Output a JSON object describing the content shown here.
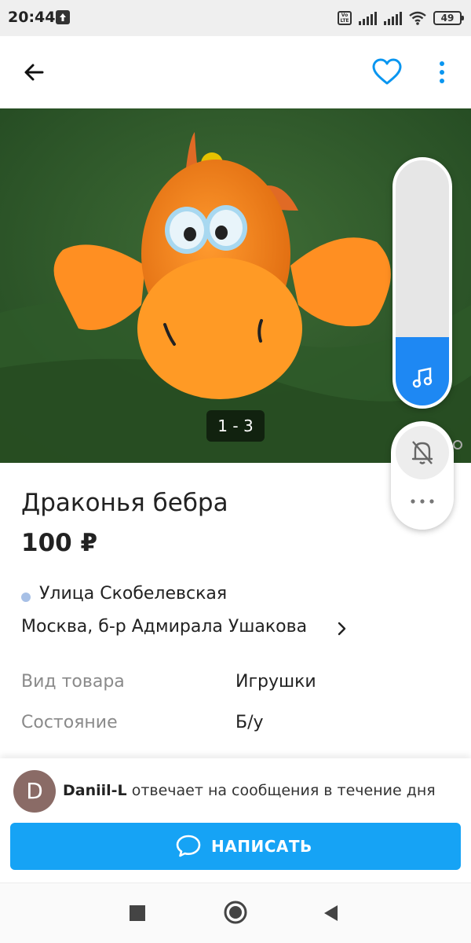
{
  "status_bar": {
    "time": "20:44",
    "volte": "Vo LTE",
    "battery": "49"
  },
  "toolbar": {
    "back_icon": "arrow-left-icon",
    "favorite_icon": "heart-outline-icon",
    "more_icon": "vertical-dots-icon",
    "accent_color": "#0a96f0"
  },
  "gallery": {
    "counter": "1 - 3"
  },
  "music_widget": {
    "level_fraction": 0.28,
    "fill_color": "#1e88f3",
    "icon": "music-note-icon"
  },
  "side_pill": {
    "bell_icon": "bell-off-icon",
    "dots_icon": "more-dots-icon"
  },
  "listing": {
    "title": "Драконья бебра",
    "price": "100 ₽",
    "street": "Улица Скобелевская",
    "address": "Москва, б-р Адмирала Ушакова",
    "params": [
      {
        "key": "Вид товара",
        "value": "Игрушки"
      },
      {
        "key": "Состояние",
        "value": "Б/у"
      }
    ]
  },
  "contact": {
    "avatar_letter": "D",
    "seller_name": "Daniil-L",
    "reply_text": " отвечает на сообщения в течение дня",
    "button_label": "НАПИСАТЬ",
    "button_color": "#16a3f5"
  },
  "nav": {
    "recents_icon": "square-icon",
    "home_icon": "circle-home-icon",
    "back_icon": "triangle-back-icon"
  }
}
